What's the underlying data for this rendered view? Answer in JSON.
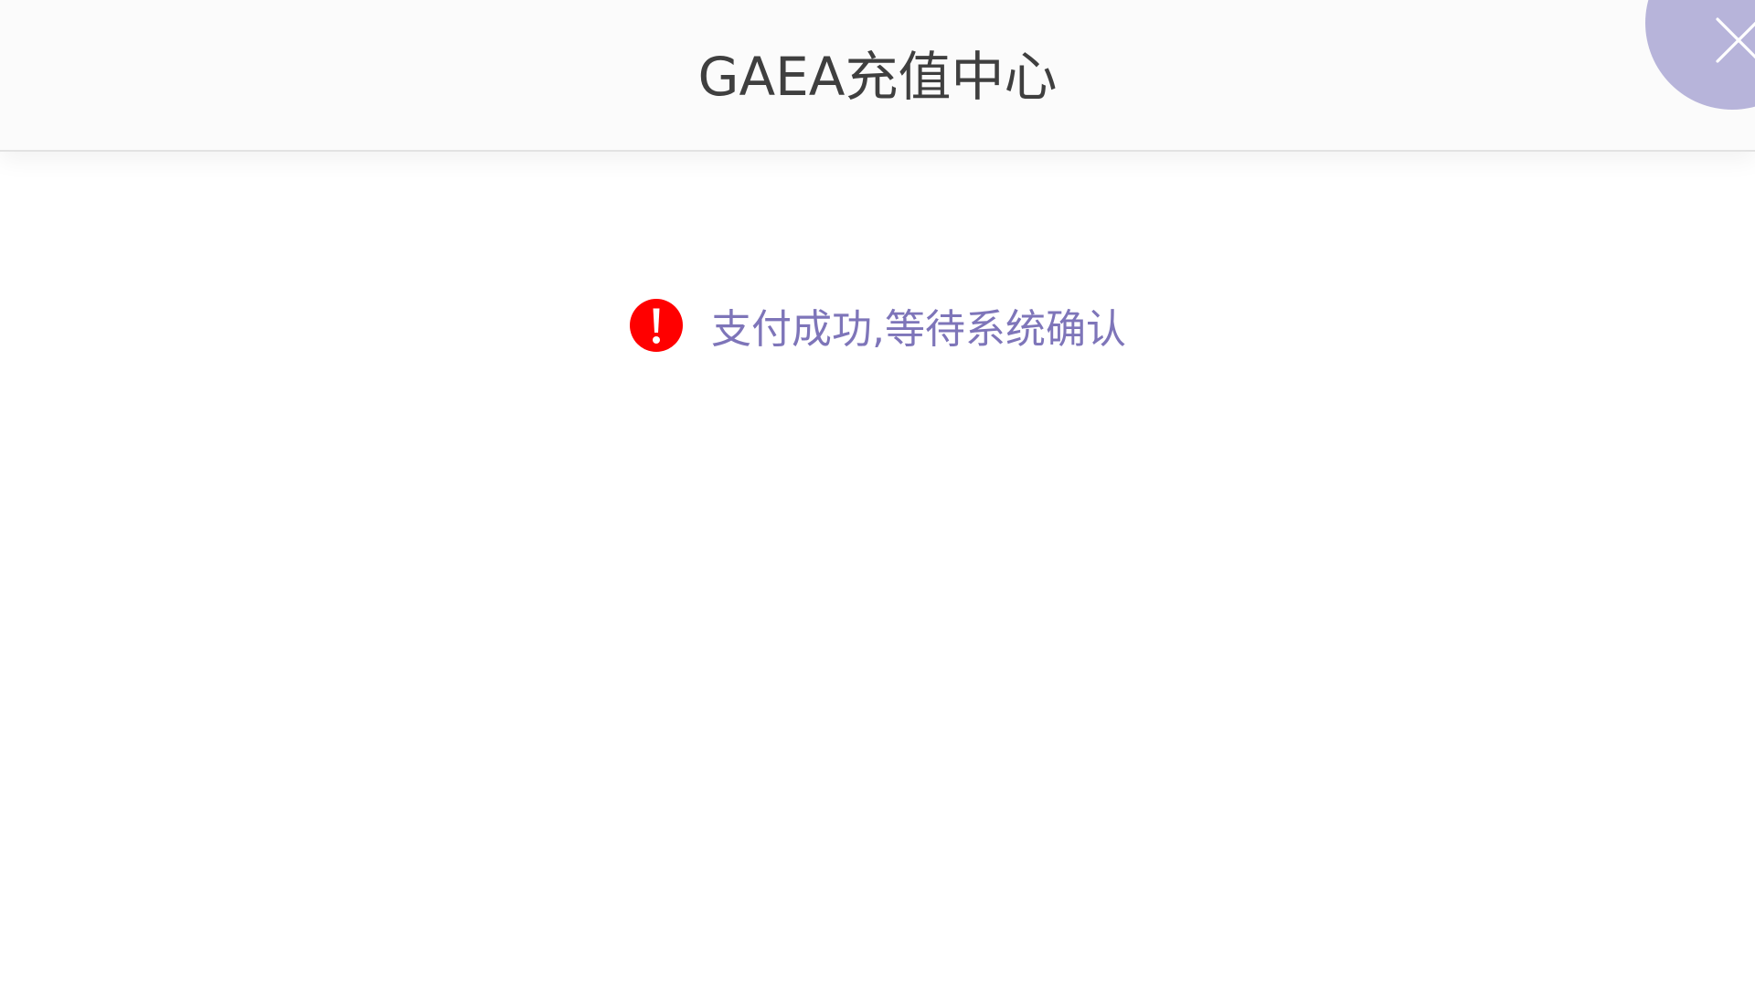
{
  "header": {
    "title": "GAEA充值中心",
    "close_icon": "close-icon"
  },
  "status": {
    "icon": "exclamation-circle-icon",
    "message": "支付成功,等待系统确认"
  },
  "colors": {
    "header_background": "#fbfbfb",
    "title_text": "#3f3f3f",
    "accent_purple": "#7e75b9",
    "close_button_background": "#b7b4da",
    "alert_red": "#ff0000"
  }
}
